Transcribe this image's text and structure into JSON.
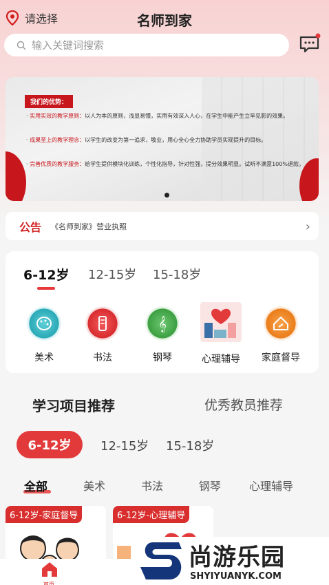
{
  "header": {
    "location_label": "请选择",
    "title": "名师到家"
  },
  "search": {
    "placeholder": "输入关键词搜索"
  },
  "banner": {
    "heading": "我们的优势：",
    "lines": [
      {
        "highlight": "实用实效的教学原则：",
        "text": "以人为本的原则，浅显易懂，实用有效深入人心，在学生中能产生立竿见影的效果。"
      },
      {
        "highlight": "成果至上的教学理念：",
        "text": "以学生的改变为第一追求，敬业，用心全心全力协助学员实现提升的目标。"
      },
      {
        "highlight": "完善优质的教学服务：",
        "text": "给学生提供模块化训练，个性化指导，针对性强，提分效果明显。试听不满意100%退款。"
      }
    ]
  },
  "notice": {
    "tag": "公告",
    "text": "《名师到家》营业执照"
  },
  "categories": {
    "age_tabs": [
      "6-12岁",
      "12-15岁",
      "15-18岁"
    ],
    "items": [
      {
        "label": "美术",
        "icon": "palette-icon",
        "color": "#3ab7c4"
      },
      {
        "label": "书法",
        "icon": "brush-icon",
        "color": "#e8383a"
      },
      {
        "label": "钢琴",
        "icon": "music-note-icon",
        "color": "#4caf50"
      },
      {
        "label": "心理辅导",
        "icon": "counseling-photo-icon",
        "color": "#e8383a"
      },
      {
        "label": "家庭督导",
        "icon": "home-supervision-icon",
        "color": "#f08a24"
      }
    ]
  },
  "recommend": {
    "title": "学习项目推荐",
    "title_alt": "优秀教员推荐",
    "age_pills": [
      "6-12岁",
      "12-15岁",
      "15-18岁"
    ],
    "sub_tabs": [
      "全部",
      "美术",
      "书法",
      "钢琴",
      "心理辅导"
    ],
    "cards": [
      {
        "tag": "6-12岁-家庭督导"
      },
      {
        "tag": "6-12岁-心理辅导"
      }
    ]
  },
  "tabbar": {
    "home_label": "首页"
  },
  "watermark": {
    "title": "尚游乐园",
    "url": "SHYIYUANYK.COM"
  },
  "colors": {
    "accent": "#e23a3a",
    "header_bg": "#f8d2d2"
  }
}
